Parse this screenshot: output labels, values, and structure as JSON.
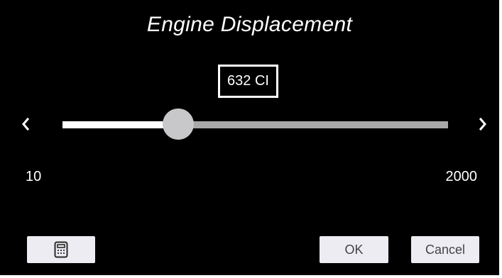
{
  "dialog": {
    "title": "Engine Displacement",
    "value_display": "632 CI"
  },
  "slider": {
    "min_label": "10",
    "max_label": "2000",
    "min": 10,
    "max": 2000,
    "value": 632,
    "left_arrow_icon": "chevron-left-icon",
    "right_arrow_icon": "chevron-right-icon"
  },
  "buttons": {
    "calculator_icon": "calculator-icon",
    "ok_label": "OK",
    "cancel_label": "Cancel"
  },
  "colors": {
    "background": "#000000",
    "track_filled": "#ffffff",
    "track_empty": "#a9a9a9",
    "thumb": "#c8c8cb",
    "button_bg": "#ececf2",
    "button_text": "#444448"
  }
}
